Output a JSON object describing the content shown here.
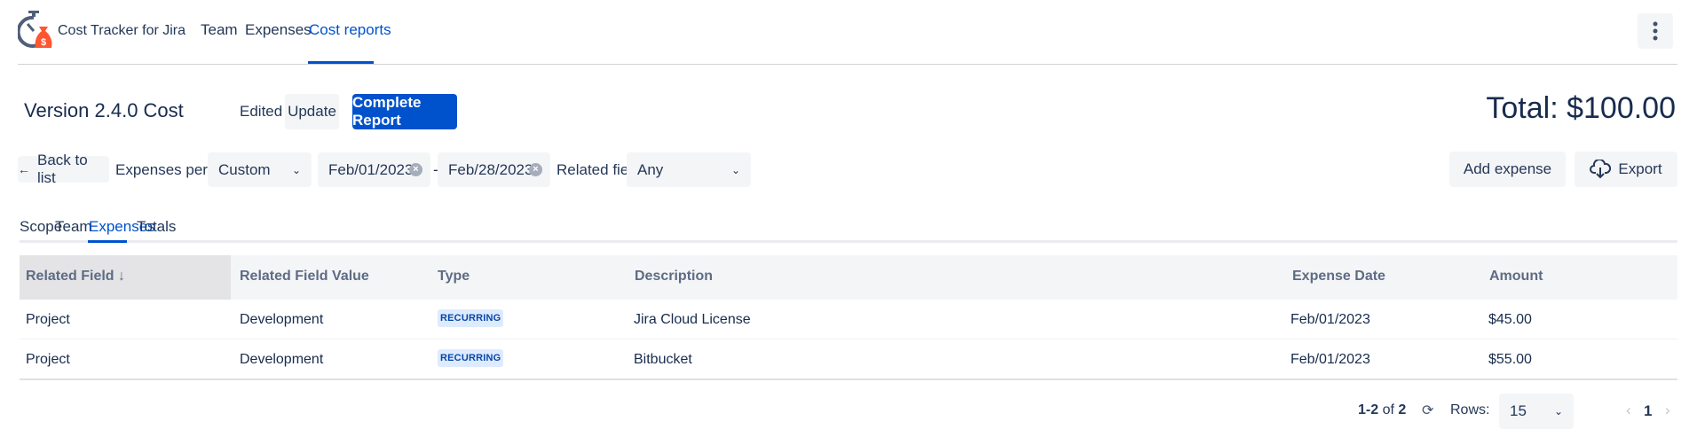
{
  "app": {
    "title": "Cost Tracker for Jira",
    "more_icon": "more-vertical-icon"
  },
  "nav": [
    {
      "label": "Team"
    },
    {
      "label": "Expenses"
    },
    {
      "label": "Cost reports",
      "active": true
    }
  ],
  "report": {
    "title": "Version 2.4.0 Cost",
    "status": "Edited",
    "update_label": "Update",
    "complete_label": "Complete Report",
    "total": "Total: $100.00"
  },
  "filters": {
    "back_label": "Back to list",
    "period_label": "Expenses period:",
    "period_value": "Custom",
    "date_from": "Feb/01/2023",
    "date_sep": "-",
    "date_to": "Feb/28/2023",
    "related_label": "Related field:",
    "related_value": "Any",
    "add_expense_label": "Add expense",
    "export_label": "Export"
  },
  "tabs": [
    {
      "label": "Scope"
    },
    {
      "label": "Team"
    },
    {
      "label": "Expenses",
      "active": true
    },
    {
      "label": "Totals"
    }
  ],
  "table": {
    "headers": [
      "Related Field",
      "Related Field Value",
      "Type",
      "Description",
      "Expense Date",
      "Amount"
    ],
    "sort_indicator": "↓",
    "rows": [
      [
        "Project",
        "Development",
        "RECURRING",
        "Jira Cloud License",
        "Feb/01/2023",
        "$45.00"
      ],
      [
        "Project",
        "Development",
        "RECURRING",
        "Bitbucket",
        "Feb/01/2023",
        "$55.00"
      ]
    ]
  },
  "pagination": {
    "range": "1-2",
    "of": "of",
    "total": "2",
    "rows_label": "Rows:",
    "rows_value": "15",
    "page": "1"
  },
  "colors": {
    "accent": "#0052cc",
    "brand_orange": "#ff5630"
  }
}
